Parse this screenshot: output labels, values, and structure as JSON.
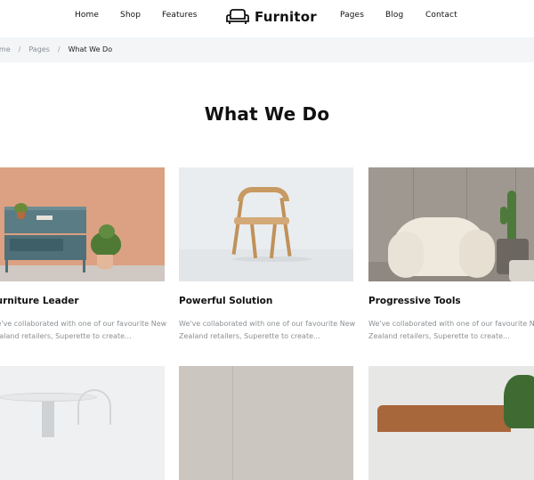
{
  "header": {
    "nav_left": [
      "Home",
      "Shop",
      "Features"
    ],
    "brand": "Furnitor",
    "nav_right": [
      "Pages",
      "Blog",
      "Contact"
    ]
  },
  "breadcrumb": {
    "items": [
      "Home",
      "Pages",
      "What We Do"
    ],
    "separator": "/"
  },
  "page_title": "What We Do",
  "cards": [
    {
      "title": "Furniture Leader",
      "desc": "We've collaborated with one of our favourite New Zealand retailers, Superette to create..."
    },
    {
      "title": "Powerful Solution",
      "desc": "We've collaborated with one of our favourite New Zealand retailers, Superette to create..."
    },
    {
      "title": "Progressive Tools",
      "desc": "We've collaborated with one of our favourite New Zealand retailers, Superette to create..."
    }
  ],
  "colors": {
    "breadcrumb_bg": "#f3f5f7",
    "muted_text": "#8b8f93",
    "text": "#111111"
  }
}
